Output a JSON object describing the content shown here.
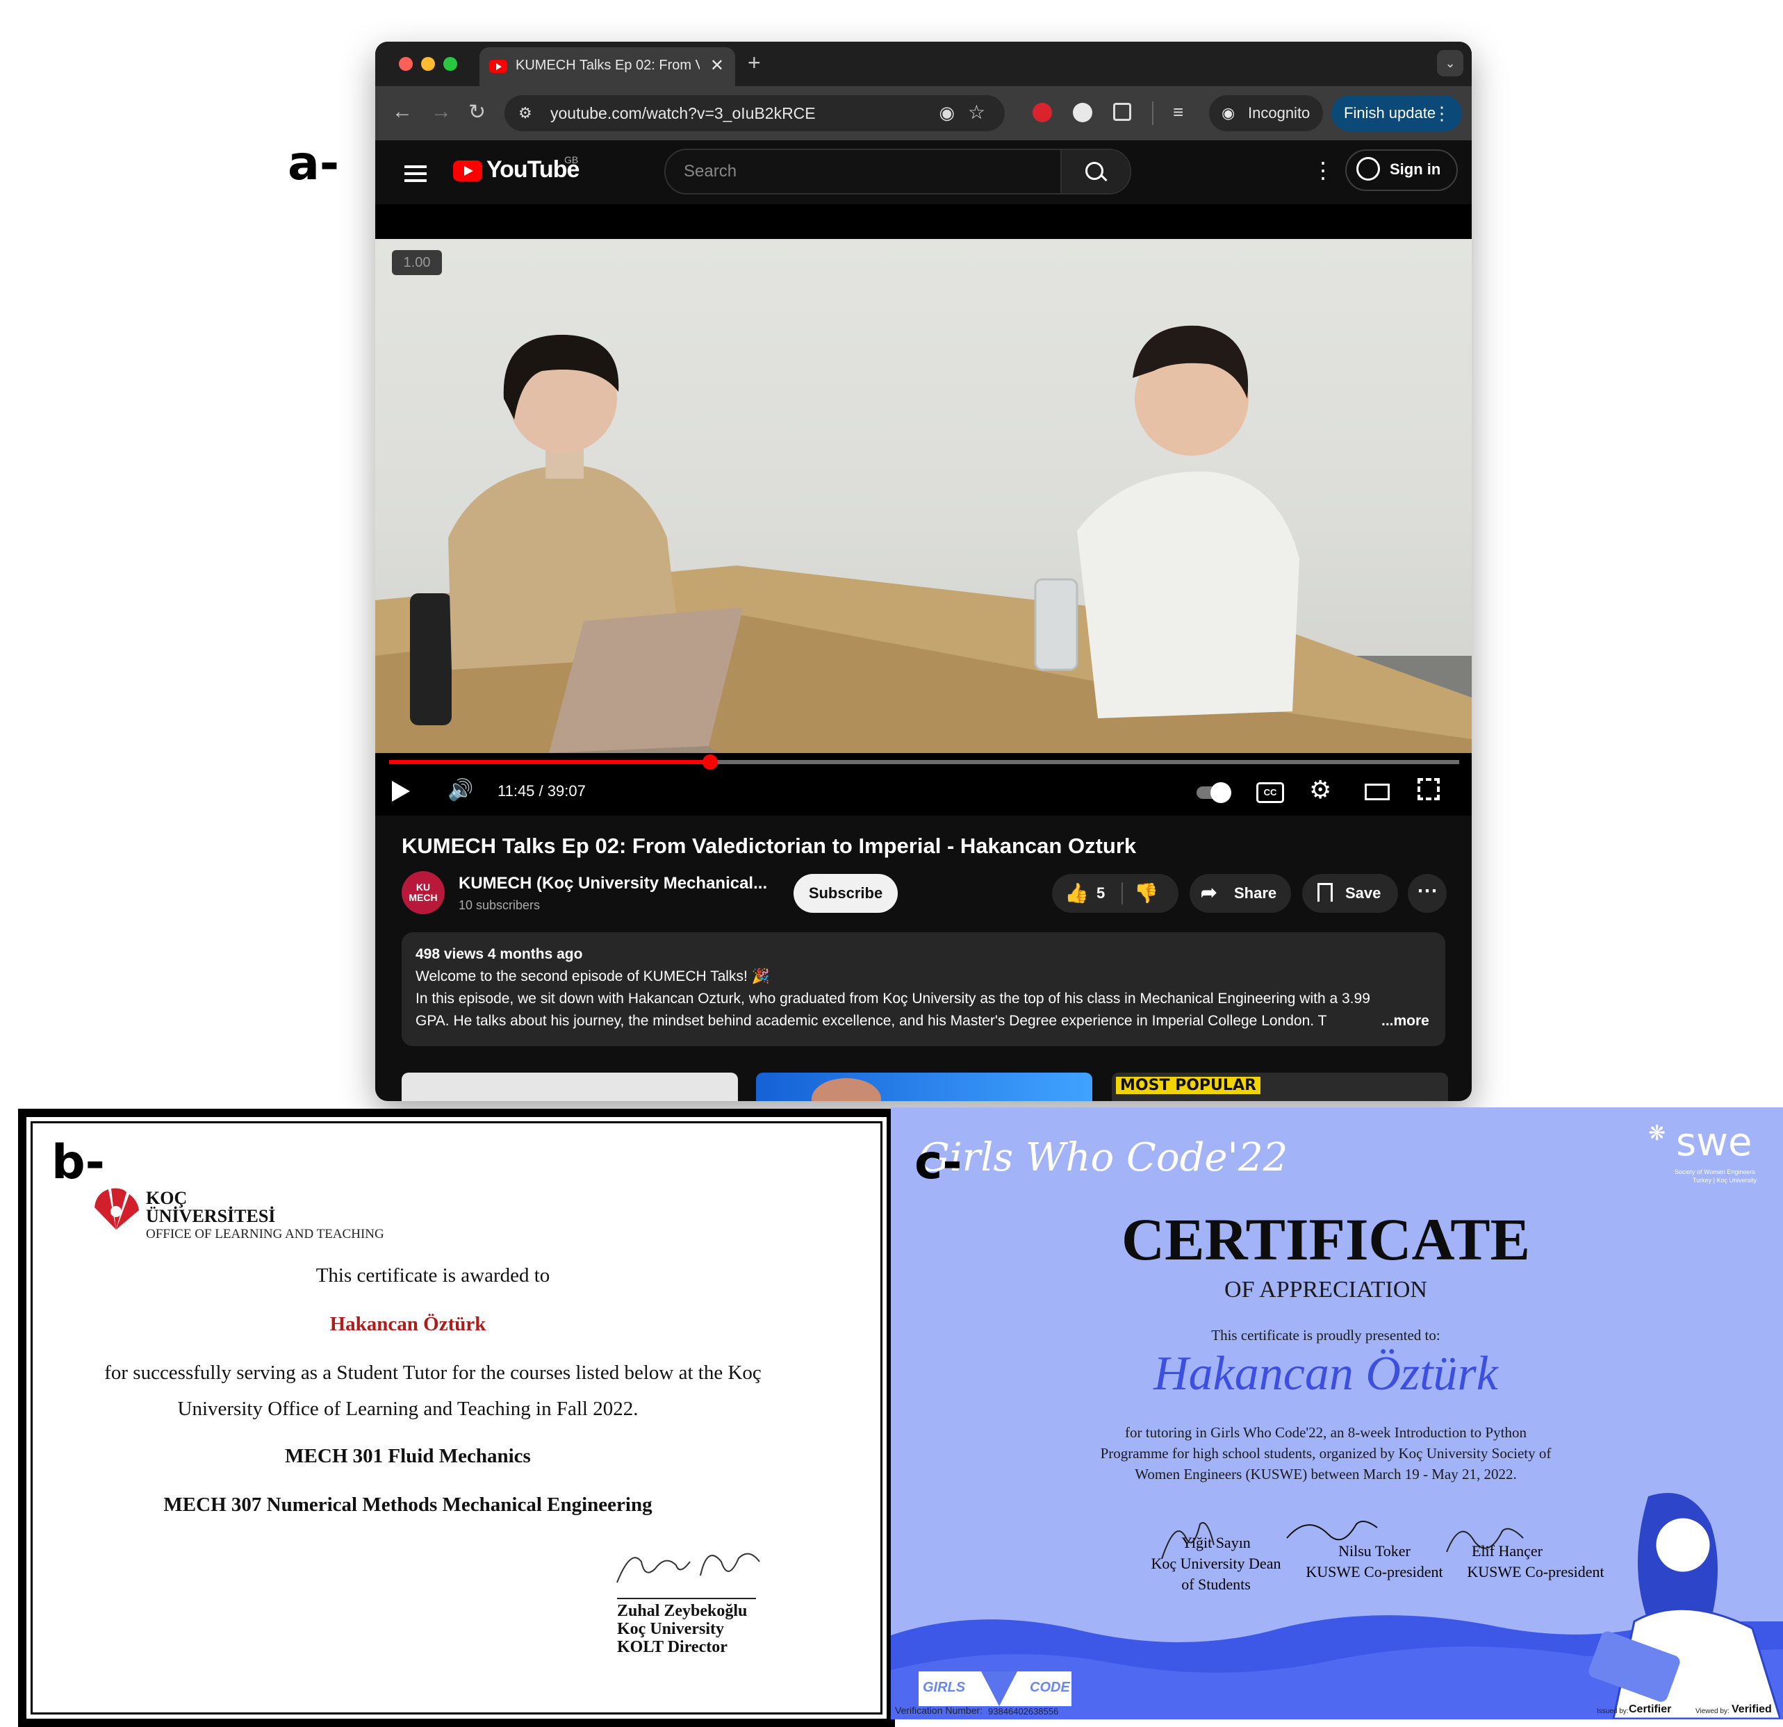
{
  "panel_labels": {
    "a": "a-",
    "b": "b-",
    "c": "c-"
  },
  "browser": {
    "tab_title": "KUMECH Talks Ep 02: From V",
    "tab_close": "✕",
    "new_tab": "+",
    "url": "youtube.com/watch?v=3_oIuB2kRCE",
    "incognito_label": "Incognito",
    "finish_update_label": "Finish update"
  },
  "youtube": {
    "logo_text": "YouTube",
    "region": "GB",
    "search_placeholder": "Search",
    "sign_in_label": "Sign in",
    "player": {
      "speed_overlay": "1.00",
      "time": "11:45 / 39:07",
      "progress_fraction": 0.3
    },
    "video_title": "KUMECH Talks Ep 02: From Valedictorian to Imperial - Hakancan Ozturk",
    "channel": {
      "avatar_text": "KU MECH",
      "name": "KUMECH (Koç University Mechanical...",
      "subscribers": "10 subscribers",
      "subscribe_label": "Subscribe"
    },
    "actions": {
      "likes": "5",
      "share_label": "Share",
      "save_label": "Save"
    },
    "description": {
      "meta": "498 views  4 months ago",
      "line1": "Welcome to the second episode of KUMECH Talks! 🎉",
      "line2": "In this episode, we sit down with Hakancan Ozturk, who graduated from Koç University as the top of his class in Mechanical Engineering with a 3.99",
      "line3": "GPA. He talks about his journey, the mindset behind academic excellence, and his Master's Degree experience in Imperial College London. T",
      "more_label": "...more"
    },
    "thumbnail_text": "MOST POPULAR"
  },
  "cert_b": {
    "org_line1": "KOÇ",
    "org_line2": "ÜNİVERSİTESİ",
    "org_line3": "OFFICE OF LEARNING AND TEACHING",
    "awarded_to": "This certificate is awarded to",
    "name": "Hakancan Öztürk",
    "body1": "for successfully serving as a Student Tutor for the courses listed below at the Koç",
    "body2": "University Office of Learning and Teaching in Fall 2022.",
    "course1": "MECH 301 Fluid Mechanics",
    "course2": "MECH 307 Numerical Methods Mechanical Engineering",
    "signer_name": "Zuhal Zeybekoğlu",
    "signer_org": "Koç University",
    "signer_title": "KOLT Director",
    "name_color": "#b01c1c"
  },
  "cert_c": {
    "header": "Girls Who Code'22",
    "swe_logo": "swe",
    "swe_sub1": "Society of Women Engineers",
    "swe_sub2": "Turkey | Koç University",
    "title": "CERTIFICATE",
    "subtitle": "OF APPRECIATION",
    "presented": "This certificate is proudly presented to:",
    "name": "Hakancan Öztürk",
    "body1": "for tutoring in Girls Who Code'22, an 8-week Introduction to Python",
    "body2": "Programme for high school students, organized by Koç University Society of",
    "body3": "Women Engineers (KUSWE) between March 19 - May 21, 2022.",
    "sig1_name": "Yiğit Sayın",
    "sig1_title1": "Koç University Dean",
    "sig1_title2": "of Students",
    "sig2_name": "Nilsu Toker",
    "sig2_title": "KUSWE Co-president",
    "sig3_name": "Elif  Hançer",
    "sig3_title": "KUSWE Co-president",
    "gwc_girls": "GIRLS",
    "gwc_code": "CODE",
    "verification_label": "Verification Number:",
    "verification_number": "93846402638556",
    "issued_label": "Issued by:",
    "issued_by": "Certifier",
    "viewed_label": "Viewed by:",
    "viewed_by": "Verified",
    "bg_color": "#a3b3f8"
  }
}
